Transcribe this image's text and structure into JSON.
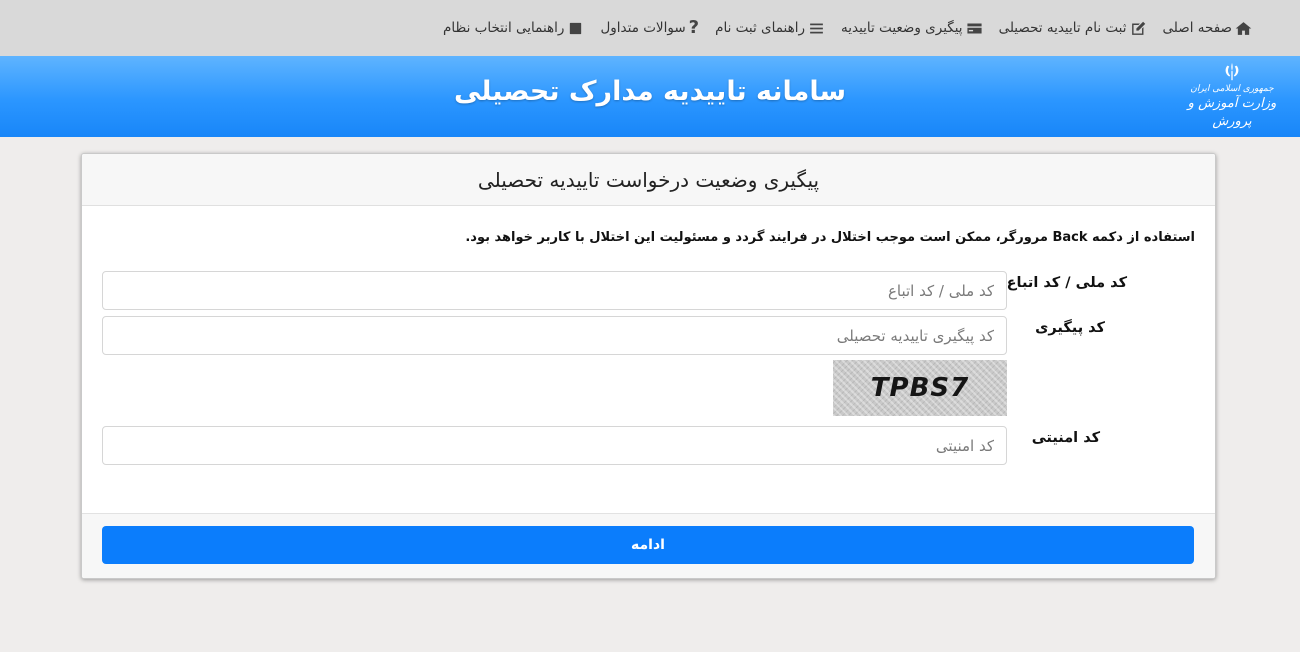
{
  "nav": {
    "items": [
      {
        "label": "صفحه اصلی",
        "icon": "home-icon"
      },
      {
        "label": "ثبت نام تاییدیه تحصیلی",
        "icon": "edit-icon"
      },
      {
        "label": "پیگیری وضعیت تاییدیه",
        "icon": "card-icon"
      },
      {
        "label": "راهنمای ثبت نام",
        "icon": "menu-lines-icon"
      },
      {
        "label": "سوالات متداول",
        "icon": "question-icon"
      },
      {
        "label": "راهنمایی انتخاب نظام",
        "icon": "square-icon"
      }
    ]
  },
  "banner": {
    "title": "سامانه تاییدیه مدارک تحصیلی",
    "logo_line1": "جمهوری اسلامی ایران",
    "logo_line2": "وزارت آموزش و پرورش"
  },
  "form": {
    "title": "پیگیری وضعیت درخواست تاییدیه تحصیلی",
    "warning": "استفاده از دکمه Back مرورگر، ممکن است موجب اختلال در فرایند گردد و مسئولیت این اختلال با کاربر خواهد بود.",
    "national_code_label": "کد ملی / کد اتباع",
    "national_code_placeholder": "کد ملی / کد اتباع",
    "tracking_label": "کد پیگیری",
    "tracking_placeholder": "کد پیگیری تاییدیه تحصیلی",
    "captcha_text": "TPBS7",
    "security_label": "کد امنیتی",
    "security_placeholder": "کد امنیتی",
    "submit_label": "ادامه"
  },
  "colors": {
    "banner": "#2b96ff",
    "primary_button": "#0b7dfc",
    "nav_bg": "#d9d9d9",
    "page_bg": "#efedec"
  }
}
